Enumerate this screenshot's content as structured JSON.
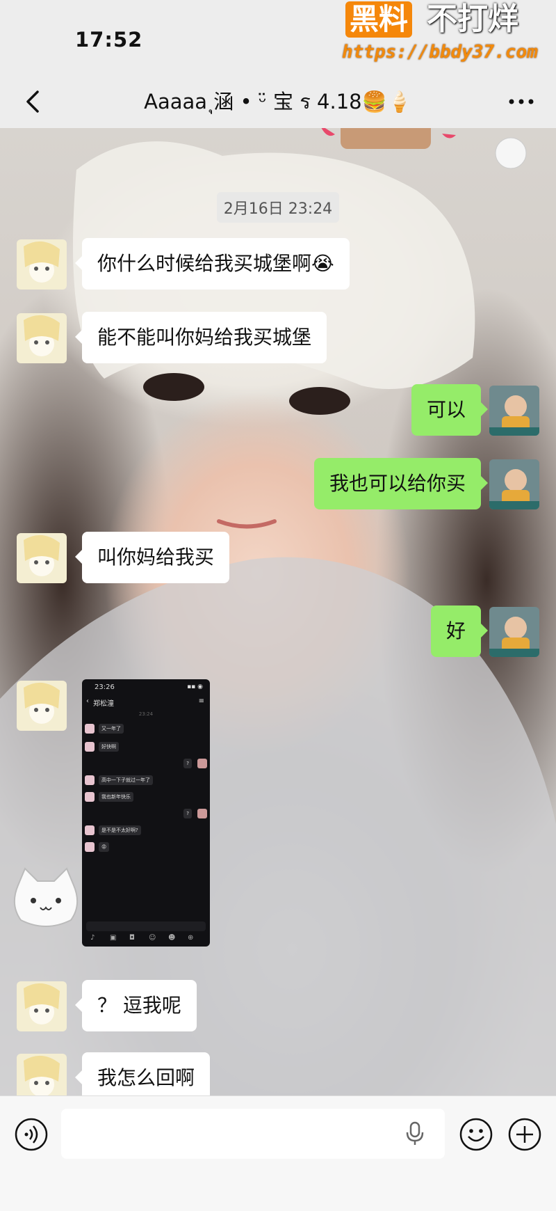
{
  "status_bar": {
    "time": "17:52"
  },
  "watermark": {
    "brand": "黑料",
    "slogan": "不打烊",
    "url": "https://bbdy37.com"
  },
  "nav": {
    "title": "Aaaaa ุ涵 • ᵕ̈ 宝 ร 4.18🍔🍦"
  },
  "chat": {
    "date": "2月16日 23:24",
    "messages": [
      {
        "side": "left",
        "text": "你什么时候给我买城堡啊😭"
      },
      {
        "side": "left",
        "text": "能不能叫你妈给我买城堡"
      },
      {
        "side": "right",
        "text": "可以"
      },
      {
        "side": "right",
        "text": "我也可以给你买"
      },
      {
        "side": "left",
        "text": "叫你妈给我买"
      },
      {
        "side": "right",
        "text": "好"
      },
      {
        "side": "left",
        "text": "？ 逗我呢"
      },
      {
        "side": "left",
        "text": "我怎么回啊"
      }
    ],
    "image_message": {
      "time": "23:26",
      "contact": "郑松潼",
      "sub_time": "23:24",
      "lines": [
        {
          "side": "left",
          "text": "又一年了"
        },
        {
          "side": "left",
          "text": "好快啊"
        },
        {
          "side": "right",
          "text": "?"
        },
        {
          "side": "left",
          "text": "高中一下子就过一年了"
        },
        {
          "side": "left",
          "text": "我也新年快乐"
        },
        {
          "side": "right",
          "text": "?"
        },
        {
          "side": "left",
          "text": "是不是不太好啊?"
        },
        {
          "side": "left",
          "text": "😡"
        }
      ]
    }
  },
  "icons": {
    "back": "chevron-left-icon",
    "more": "more-dots-icon",
    "voice": "voice-icon",
    "mic": "microphone-icon",
    "emoji": "emoji-icon",
    "plus": "plus-icon"
  },
  "colors": {
    "bubble_right": "#95ec69",
    "bubble_left": "#ffffff",
    "watermark_orange": "#f5870a"
  }
}
